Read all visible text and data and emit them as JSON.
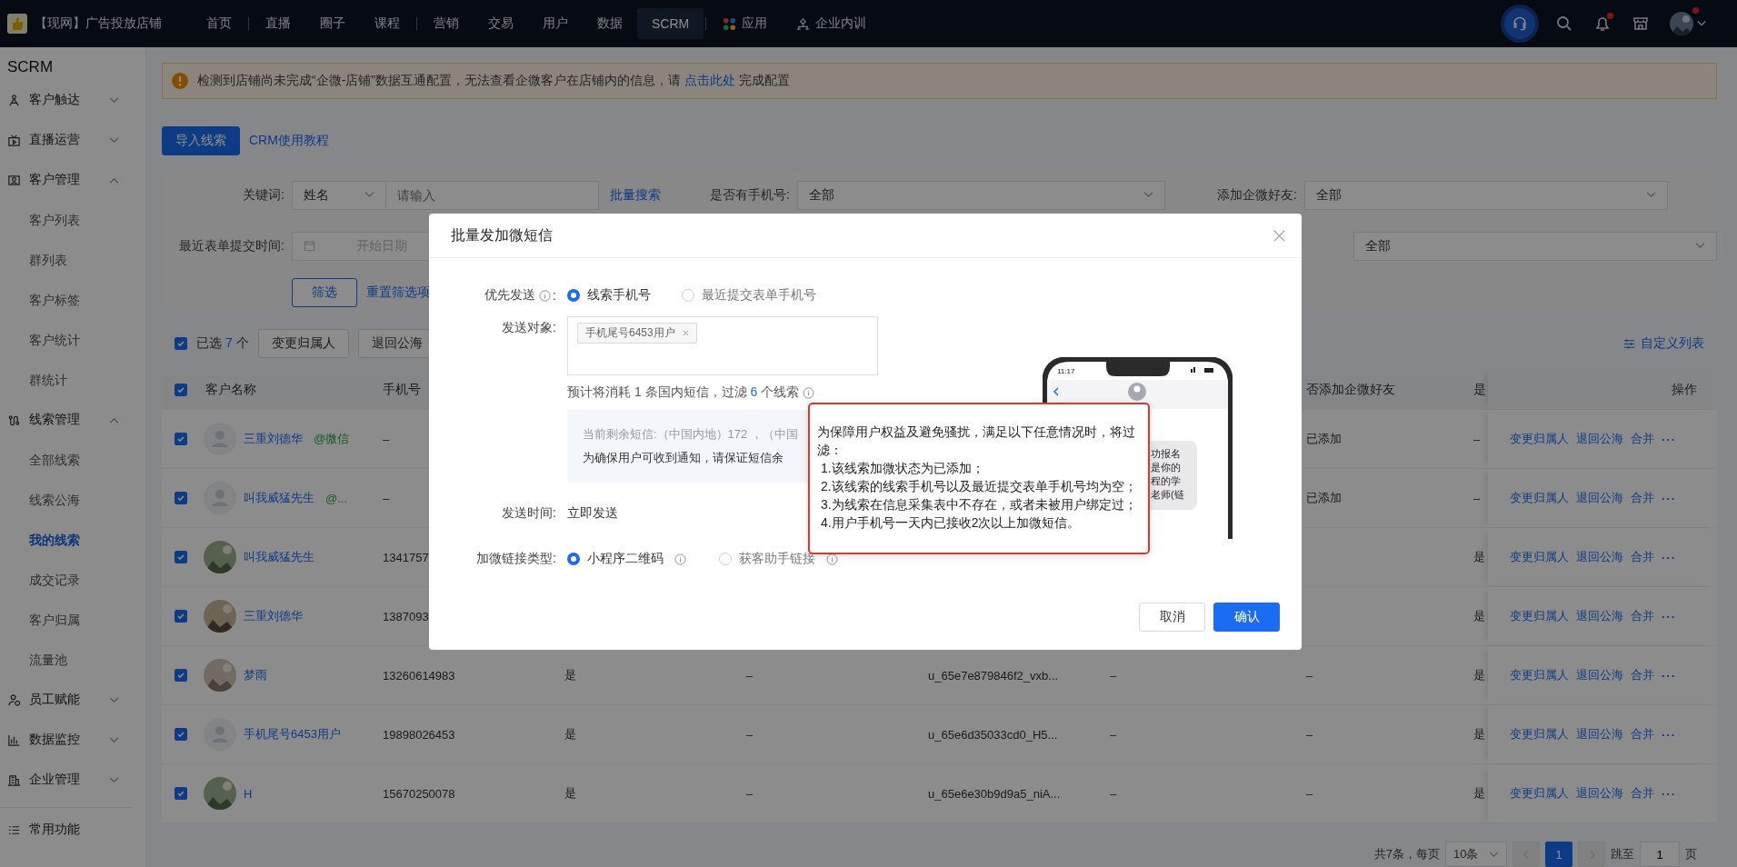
{
  "topbar": {
    "shop_name": "【现网】广告投放店铺",
    "nav_groups": [
      [
        {
          "label": "首页",
          "selected": false,
          "kind": "text"
        }
      ],
      [
        {
          "label": "直播",
          "selected": false,
          "kind": "text"
        },
        {
          "label": "圈子",
          "selected": false,
          "kind": "text"
        },
        {
          "label": "课程",
          "selected": false,
          "kind": "text"
        }
      ],
      [
        {
          "label": "营销",
          "selected": false,
          "kind": "text"
        },
        {
          "label": "交易",
          "selected": false,
          "kind": "text"
        },
        {
          "label": "用户",
          "selected": false,
          "kind": "text"
        },
        {
          "label": "数据",
          "selected": false,
          "kind": "text"
        },
        {
          "label": "SCRM",
          "selected": true,
          "kind": "text"
        }
      ],
      [
        {
          "label": "应用",
          "selected": false,
          "kind": "apps"
        },
        {
          "label": "企业内训",
          "selected": false,
          "kind": "training"
        }
      ]
    ],
    "bell_badge": true,
    "avatar_badge": true
  },
  "sidebar": {
    "title": "SCRM",
    "sections": [
      {
        "label": "客户触达",
        "kind": "reach",
        "expanded": false
      },
      {
        "label": "直播运营",
        "kind": "live",
        "expanded": false
      },
      {
        "label": "客户管理",
        "kind": "customer",
        "expanded": true,
        "children": [
          {
            "label": "客户列表",
            "selected": false
          },
          {
            "label": "群列表",
            "selected": false
          },
          {
            "label": "客户标签",
            "selected": false
          },
          {
            "label": "客户统计",
            "selected": false
          },
          {
            "label": "群统计",
            "selected": false
          }
        ]
      },
      {
        "label": "线索管理",
        "kind": "lead",
        "expanded": true,
        "children": [
          {
            "label": "全部线索",
            "selected": false
          },
          {
            "label": "线索公海",
            "selected": false
          },
          {
            "label": "我的线索",
            "selected": true
          },
          {
            "label": "成交记录",
            "selected": false
          },
          {
            "label": "客户归属",
            "selected": false
          },
          {
            "label": "流量池",
            "selected": false
          }
        ]
      },
      {
        "label": "员工赋能",
        "kind": "staff",
        "expanded": false
      },
      {
        "label": "数据监控",
        "kind": "data",
        "expanded": false
      },
      {
        "label": "企业管理",
        "kind": "company",
        "expanded": false
      }
    ],
    "footer": {
      "label": "常用功能"
    }
  },
  "alert": {
    "text_before": "检测到店铺尚未完成“企微-店铺”数据互通配置，无法查看企微客户在店铺内的信息，请 ",
    "link": "点击此处",
    "text_after": " 完成配置"
  },
  "header_actions": {
    "import_button": "导入线索",
    "tutorial_link": "CRM使用教程"
  },
  "filters": {
    "keyword": {
      "label": "关键词:",
      "select": "姓名",
      "placeholder": "请输入",
      "batch_link": "批量搜索"
    },
    "has_phone": {
      "label": "是否有手机号:",
      "value": "全部"
    },
    "wecom_friend": {
      "label": "添加企微好友:",
      "value": "全部"
    },
    "submit_time": {
      "label": "最近表单提交时间:",
      "start_placeholder": "开始日期"
    },
    "row2_select": {
      "value": "全部"
    },
    "filter_button": "筛选",
    "reset_link": "重置筛选项"
  },
  "toolbar": {
    "all_checked": true,
    "selected_label": "已选",
    "selected_count": "7",
    "selected_unit": "个",
    "buttons": [
      "变更归属人",
      "退回公海"
    ],
    "custom_columns": "自定义列表"
  },
  "table": {
    "header_checked": true,
    "headers": {
      "name": "客户名称",
      "phone": "手机号",
      "column_7": "否添加企微好友",
      "column_8": "是",
      "actions": "操作"
    },
    "rows": [
      {
        "checked": true,
        "name": "三重刘德华",
        "tag": "@微信",
        "kind": "default",
        "phone": "–",
        "column_7": "已添加",
        "column_8": "–",
        "actions": [
          "变更归属人",
          "退回公海",
          "合并",
          "···"
        ]
      },
      {
        "checked": true,
        "name": "叫我威猛先生",
        "tag": "@...",
        "kind": "default",
        "phone": "–",
        "column_7": "已添加",
        "column_8": "–",
        "actions": [
          "变更归属人",
          "退回公海",
          "合并",
          "···"
        ]
      },
      {
        "checked": true,
        "name": "叫我威猛先生",
        "phone": "1341757",
        "column_8": "是",
        "actions": [
          "变更归属人",
          "退回公海",
          "合并",
          "···"
        ]
      },
      {
        "checked": true,
        "name": "三重刘德华",
        "phone": "1387093",
        "column_8": "是",
        "actions": [
          "变更归属人",
          "退回公海",
          "合并",
          "···"
        ]
      },
      {
        "checked": true,
        "name": "梦雨",
        "phone": "13260614983",
        "column_3": "是",
        "column_4": "–",
        "column_5": "u_65e7e879846f2_vxb...",
        "column_6": "–",
        "column_7": "–",
        "column_8": "是",
        "actions": [
          "变更归属人",
          "退回公海",
          "合并",
          "···"
        ]
      },
      {
        "checked": true,
        "name": "手机尾号6453用户",
        "kind": "default",
        "phone": "19898026453",
        "column_3": "是",
        "column_4": "–",
        "column_5": "u_65e6d35033cd0_H5...",
        "column_6": "–",
        "column_7": "–",
        "column_8": "是",
        "actions": [
          "变更归属人",
          "退回公海",
          "合并",
          "···"
        ]
      },
      {
        "checked": true,
        "name": "H",
        "phone": "15670250078",
        "column_3": "是",
        "column_4": "–",
        "column_5": "u_65e6e30b9d9a5_niA...",
        "column_6": "–",
        "column_7": "–",
        "column_8": "是",
        "actions": [
          "变更归属人",
          "退回公海",
          "合并",
          "···"
        ]
      }
    ]
  },
  "pagination": {
    "total": "共7条，每页",
    "page_size": "10条",
    "prev_disabled": true,
    "pages": [
      {
        "label": "1",
        "selected": true
      }
    ],
    "next_disabled": true,
    "jump_label": "跳至",
    "jump_value": "1",
    "page_unit": "页"
  },
  "modal": {
    "title": "批量发加微短信",
    "priority": {
      "label": "优先发送",
      "suffix": ":",
      "options": [
        {
          "label": "线索手机号",
          "selected": true
        },
        {
          "label": "最近提交表单手机号",
          "selected": false
        }
      ]
    },
    "target": {
      "label": "发送对象:",
      "tags": [
        "手机尾号6453用户"
      ]
    },
    "estimate": {
      "before": "预计将消耗 1 条国内短信，过滤 ",
      "count": "6",
      "after": " 个线索"
    },
    "balance_lines": [
      "当前剩余短信:（中国内地）172 ，（中国",
      "为确保用户可收到通知，请保证短信余"
    ],
    "send_time": {
      "label": "发送时间:",
      "value": "立即发送"
    },
    "link_type": {
      "label": "加微链接类型:",
      "options": [
        {
          "label": "小程序二维码",
          "selected": true
        },
        {
          "label": "获客助手链接",
          "selected": false
        }
      ]
    },
    "cancel_button": "取消",
    "confirm_button": "确认",
    "phone_preview": {
      "time": "11:17",
      "message_lines": [
        "功报名",
        "是你的",
        "程的学",
        "老师(链"
      ]
    },
    "tooltip": {
      "intro": "为保障用户权益及避免骚扰，满足以下任意情况时，将过滤：",
      "items": [
        "1.该线索加微状态为已添加；",
        "2.该线索的线索手机号以及最近提交表单手机号均为空；",
        "3.为线索在信息采集表中不存在，或者未被用户绑定过；",
        "4.用户手机号一天内已接收2次以上加微短信。"
      ]
    }
  }
}
